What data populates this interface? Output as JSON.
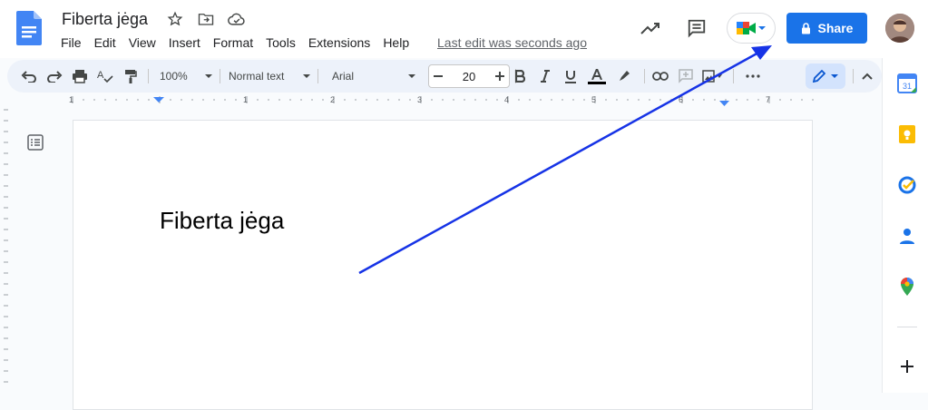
{
  "doc": {
    "title": "Fiberta jėga",
    "body_text": "Fiberta jėga"
  },
  "menu": [
    "File",
    "Edit",
    "View",
    "Insert",
    "Format",
    "Tools",
    "Extensions",
    "Help"
  ],
  "last_edit": "Last edit was seconds ago",
  "share_label": "Share",
  "toolbar": {
    "zoom": "100%",
    "style": "Normal text",
    "font": "Arial",
    "font_size": "20"
  },
  "ruler_numbers": [
    "1",
    "1",
    "2",
    "3",
    "4",
    "5",
    "6",
    "7"
  ],
  "calendar_day": "31",
  "colors": {
    "accent": "#1a73e8",
    "annotation_arrow": "#1633e6"
  }
}
